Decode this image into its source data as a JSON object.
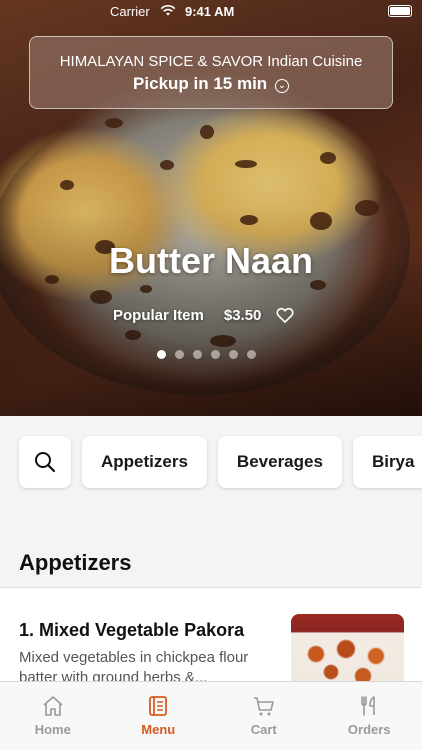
{
  "status_bar": {
    "carrier": "Carrier",
    "time": "9:41 AM"
  },
  "restaurant": {
    "name": "HIMALAYAN SPICE & SAVOR Indian Cuisine",
    "pickup": "Pickup in 15 min"
  },
  "hero": {
    "title": "Butter Naan",
    "tag": "Popular Item",
    "price": "$3.50",
    "page_count": 6,
    "active_page": 1
  },
  "categories": [
    "Appetizers",
    "Beverages",
    "Birya"
  ],
  "section": {
    "title": "Appetizers"
  },
  "item": {
    "title": "1. Mixed Vegetable Pakora",
    "description": "Mixed vegetables in chickpea flour batter with ground herbs &..."
  },
  "tabs": [
    {
      "label": "Home",
      "icon": "home-icon"
    },
    {
      "label": "Menu",
      "icon": "menu-icon"
    },
    {
      "label": "Cart",
      "icon": "cart-icon"
    },
    {
      "label": "Orders",
      "icon": "fork-knife-icon"
    }
  ],
  "colors": {
    "accent": "#d65a1e",
    "inactive": "#9a9a9a"
  }
}
